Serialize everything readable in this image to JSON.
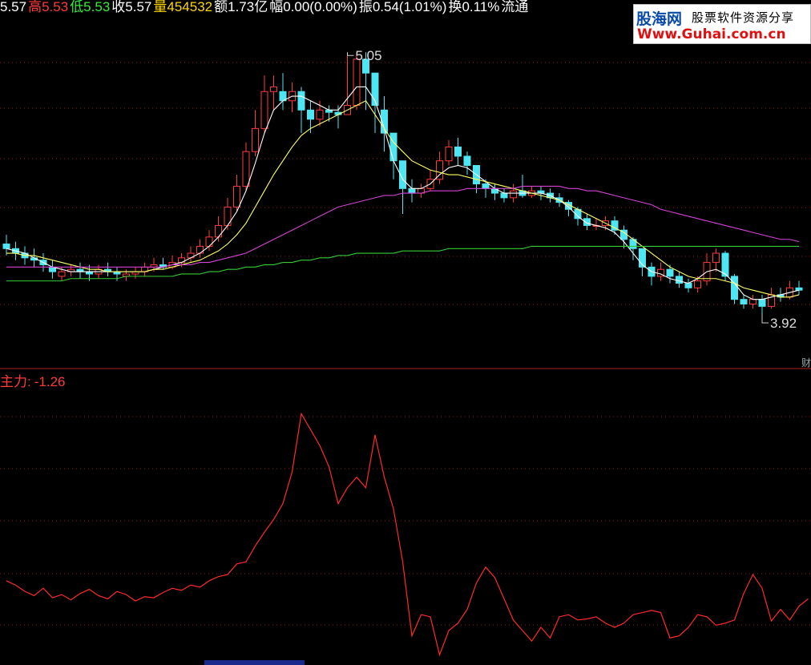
{
  "colors": {
    "background": "#000000",
    "up_candle": "#ff3a3a",
    "down_candle": "#4de6f2",
    "ma5": "#ffffff",
    "ma10": "#ffff66",
    "ma30": "#d442d4",
    "ma60": "#33cc33",
    "indicator": "#ff2a2a",
    "grid": "#8b1a1a"
  },
  "top_info": [
    {
      "text": "5.57",
      "color": "#ffffff"
    },
    {
      "text": "高5.53",
      "color": "#ff3a3a"
    },
    {
      "text": "低5.53",
      "color": "#33ee33"
    },
    {
      "text": "收5.57",
      "color": "#ffffff"
    },
    {
      "text": "量454532",
      "color": "#ffd700"
    },
    {
      "text": "额1.73亿",
      "color": "#ffffff"
    },
    {
      "text": "幅0.00(0.00%)",
      "color": "#ffffff"
    },
    {
      "text": "振0.54(1.01%)",
      "color": "#ffffff"
    },
    {
      "text": "换0.11%",
      "color": "#ffffff"
    },
    {
      "text": "流通",
      "color": "#ffffff"
    }
  ],
  "logo": {
    "brand": "股海网",
    "slogan": "股票软件资源分享",
    "url": "Www.Guhai.com.cn"
  },
  "indicator": {
    "name": "主力:",
    "value": "-1.26"
  },
  "side_tag": "财",
  "chart_data": [
    {
      "type": "candlestick",
      "annotations": [
        {
          "text": "5.05",
          "role": "high"
        },
        {
          "text": "3.92",
          "role": "low"
        }
      ],
      "ylim": [
        3.75,
        5.2
      ],
      "candles": [
        [
          4.22,
          4.2,
          4.26,
          4.17
        ],
        [
          4.2,
          4.18,
          4.23,
          4.15
        ],
        [
          4.18,
          4.16,
          4.21,
          4.13
        ],
        [
          4.16,
          4.15,
          4.2,
          4.12
        ],
        [
          4.15,
          4.13,
          4.18,
          4.1
        ],
        [
          4.12,
          4.1,
          4.15,
          4.07
        ],
        [
          4.08,
          4.1,
          4.12,
          4.06
        ],
        [
          4.1,
          4.11,
          4.13,
          4.08
        ],
        [
          4.11,
          4.1,
          4.14,
          4.07
        ],
        [
          4.1,
          4.09,
          4.13,
          4.06
        ],
        [
          4.09,
          4.11,
          4.13,
          4.07
        ],
        [
          4.11,
          4.1,
          4.14,
          4.08
        ],
        [
          4.1,
          4.09,
          4.12,
          4.06
        ],
        [
          4.08,
          4.09,
          4.11,
          4.06
        ],
        [
          4.09,
          4.1,
          4.12,
          4.07
        ],
        [
          4.1,
          4.12,
          4.14,
          4.08
        ],
        [
          4.12,
          4.13,
          4.16,
          4.1
        ],
        [
          4.13,
          4.12,
          4.16,
          4.11
        ],
        [
          4.12,
          4.14,
          4.17,
          4.11
        ],
        [
          4.14,
          4.16,
          4.18,
          4.12
        ],
        [
          4.16,
          4.18,
          4.21,
          4.14
        ],
        [
          4.18,
          4.21,
          4.24,
          4.16
        ],
        [
          4.21,
          4.25,
          4.28,
          4.19
        ],
        [
          4.25,
          4.3,
          4.34,
          4.23
        ],
        [
          4.3,
          4.38,
          4.42,
          4.28
        ],
        [
          4.38,
          4.47,
          4.52,
          4.36
        ],
        [
          4.47,
          4.62,
          4.66,
          4.45
        ],
        [
          4.62,
          4.72,
          4.8,
          4.6
        ],
        [
          4.72,
          4.88,
          4.95,
          4.7
        ],
        [
          4.88,
          4.9,
          4.95,
          4.8
        ],
        [
          4.88,
          4.84,
          4.96,
          4.8
        ],
        [
          4.84,
          4.88,
          4.92,
          4.79
        ],
        [
          4.88,
          4.8,
          4.9,
          4.7
        ],
        [
          4.8,
          4.76,
          4.84,
          4.7
        ],
        [
          4.76,
          4.8,
          4.84,
          4.73
        ],
        [
          4.8,
          4.79,
          4.82,
          4.75
        ],
        [
          4.79,
          4.78,
          4.82,
          4.72
        ],
        [
          4.78,
          4.82,
          5.05,
          4.78
        ],
        [
          4.82,
          5.02,
          5.05,
          4.8
        ],
        [
          5.02,
          4.96,
          5.05,
          4.8
        ],
        [
          4.96,
          4.82,
          4.85,
          4.7
        ],
        [
          4.8,
          4.7,
          4.86,
          4.62
        ],
        [
          4.7,
          4.58,
          4.6,
          4.5
        ],
        [
          4.58,
          4.46,
          4.48,
          4.35
        ],
        [
          4.46,
          4.44,
          4.5,
          4.4
        ],
        [
          4.44,
          4.46,
          4.48,
          4.42
        ],
        [
          4.46,
          4.5,
          4.54,
          4.45
        ],
        [
          4.5,
          4.58,
          4.62,
          4.48
        ],
        [
          4.58,
          4.64,
          4.67,
          4.56
        ],
        [
          4.64,
          4.6,
          4.68,
          4.56
        ],
        [
          4.6,
          4.56,
          4.62,
          4.52
        ],
        [
          4.56,
          4.48,
          4.55,
          4.44
        ],
        [
          4.48,
          4.46,
          4.5,
          4.42
        ],
        [
          4.46,
          4.44,
          4.48,
          4.41
        ],
        [
          4.44,
          4.42,
          4.46,
          4.4
        ],
        [
          4.42,
          4.45,
          4.48,
          4.4
        ],
        [
          4.45,
          4.43,
          4.52,
          4.42
        ],
        [
          4.43,
          4.45,
          4.47,
          4.42
        ],
        [
          4.45,
          4.44,
          4.47,
          4.41
        ],
        [
          4.44,
          4.42,
          4.46,
          4.4
        ],
        [
          4.42,
          4.4,
          4.44,
          4.38
        ],
        [
          4.4,
          4.37,
          4.41,
          4.34
        ],
        [
          4.37,
          4.33,
          4.38,
          4.3
        ],
        [
          4.33,
          4.3,
          4.35,
          4.28
        ],
        [
          4.3,
          4.3,
          4.33,
          4.28
        ],
        [
          4.3,
          4.32,
          4.34,
          4.28
        ],
        [
          4.32,
          4.28,
          4.34,
          4.26
        ],
        [
          4.28,
          4.24,
          4.3,
          4.2
        ],
        [
          4.24,
          4.2,
          4.25,
          4.15
        ],
        [
          4.2,
          4.12,
          4.2,
          4.08
        ],
        [
          4.12,
          4.08,
          4.14,
          4.04
        ],
        [
          4.08,
          4.11,
          4.14,
          4.06
        ],
        [
          4.11,
          4.08,
          4.13,
          4.05
        ],
        [
          4.08,
          4.05,
          4.1,
          4.03
        ],
        [
          4.05,
          4.03,
          4.07,
          4.01
        ],
        [
          4.03,
          4.06,
          4.08,
          4.01
        ],
        [
          4.06,
          4.14,
          4.18,
          4.04
        ],
        [
          4.14,
          4.18,
          4.2,
          4.1
        ],
        [
          4.18,
          4.08,
          4.19,
          4.06
        ],
        [
          4.08,
          3.98,
          4.09,
          3.96
        ],
        [
          3.98,
          3.96,
          4.0,
          3.94
        ],
        [
          3.96,
          3.98,
          4.0,
          3.94
        ],
        [
          3.98,
          3.95,
          4.0,
          3.92
        ],
        [
          3.95,
          4.0,
          4.03,
          3.94
        ],
        [
          4.0,
          3.99,
          4.03,
          3.97
        ],
        [
          3.99,
          4.03,
          4.06,
          3.98
        ],
        [
          4.03,
          4.02,
          4.06,
          4.0
        ]
      ],
      "series": [
        {
          "name": "MA5",
          "values": [
            4.2,
            4.19,
            4.18,
            4.16,
            4.14,
            4.12,
            4.11,
            4.1,
            4.1,
            4.1,
            4.1,
            4.1,
            4.1,
            4.1,
            4.1,
            4.1,
            4.11,
            4.12,
            4.13,
            4.14,
            4.16,
            4.18,
            4.21,
            4.25,
            4.3,
            4.36,
            4.45,
            4.57,
            4.7,
            4.8,
            4.84,
            4.86,
            4.86,
            4.84,
            4.82,
            4.8,
            4.8,
            4.85,
            4.9,
            4.9,
            4.84,
            4.72,
            4.58,
            4.5,
            4.46,
            4.46,
            4.48,
            4.52,
            4.55,
            4.56,
            4.55,
            4.52,
            4.49,
            4.46,
            4.44,
            4.44,
            4.44,
            4.44,
            4.44,
            4.43,
            4.41,
            4.38,
            4.34,
            4.31,
            4.3,
            4.29,
            4.27,
            4.23,
            4.18,
            4.13,
            4.1,
            4.09,
            4.07,
            4.06,
            4.05,
            4.07,
            4.1,
            4.11,
            4.09,
            4.05,
            4.0,
            3.98,
            3.98,
            3.99,
            4.0,
            4.01,
            4.02
          ]
        },
        {
          "name": "MA10",
          "values": [
            4.18,
            4.18,
            4.17,
            4.17,
            4.16,
            4.15,
            4.14,
            4.13,
            4.12,
            4.11,
            4.11,
            4.1,
            4.1,
            4.1,
            4.1,
            4.1,
            4.11,
            4.11,
            4.12,
            4.13,
            4.14,
            4.15,
            4.17,
            4.19,
            4.22,
            4.26,
            4.31,
            4.38,
            4.45,
            4.52,
            4.58,
            4.64,
            4.69,
            4.72,
            4.74,
            4.76,
            4.78,
            4.8,
            4.82,
            4.84,
            4.78,
            4.72,
            4.66,
            4.62,
            4.58,
            4.56,
            4.54,
            4.53,
            4.52,
            4.52,
            4.51,
            4.5,
            4.49,
            4.48,
            4.47,
            4.46,
            4.45,
            4.44,
            4.43,
            4.42,
            4.41,
            4.39,
            4.37,
            4.35,
            4.33,
            4.31,
            4.29,
            4.27,
            4.24,
            4.21,
            4.18,
            4.15,
            4.12,
            4.1,
            4.08,
            4.07,
            4.07,
            4.07,
            4.06,
            4.05,
            4.03,
            4.02,
            4.01,
            4.0,
            3.99,
            3.99,
            4.0
          ]
        },
        {
          "name": "MA30",
          "values": [
            4.12,
            4.12,
            4.12,
            4.12,
            4.12,
            4.12,
            4.12,
            4.12,
            4.12,
            4.12,
            4.12,
            4.12,
            4.12,
            4.12,
            4.12,
            4.12,
            4.12,
            4.12,
            4.13,
            4.13,
            4.13,
            4.14,
            4.14,
            4.15,
            4.16,
            4.17,
            4.18,
            4.2,
            4.22,
            4.24,
            4.26,
            4.28,
            4.3,
            4.32,
            4.34,
            4.36,
            4.38,
            4.39,
            4.4,
            4.41,
            4.42,
            4.43,
            4.43,
            4.44,
            4.44,
            4.44,
            4.45,
            4.45,
            4.45,
            4.45,
            4.46,
            4.46,
            4.46,
            4.46,
            4.46,
            4.46,
            4.47,
            4.47,
            4.47,
            4.47,
            4.47,
            4.46,
            4.46,
            4.45,
            4.45,
            4.44,
            4.43,
            4.42,
            4.41,
            4.4,
            4.39,
            4.37,
            4.36,
            4.35,
            4.34,
            4.33,
            4.32,
            4.31,
            4.3,
            4.29,
            4.28,
            4.27,
            4.26,
            4.25,
            4.24,
            4.24,
            4.23
          ]
        },
        {
          "name": "MA60",
          "values": [
            4.06,
            4.06,
            4.06,
            4.06,
            4.06,
            4.06,
            4.06,
            4.07,
            4.07,
            4.07,
            4.07,
            4.07,
            4.07,
            4.08,
            4.08,
            4.08,
            4.08,
            4.08,
            4.08,
            4.09,
            4.09,
            4.09,
            4.1,
            4.1,
            4.11,
            4.11,
            4.12,
            4.12,
            4.13,
            4.13,
            4.14,
            4.14,
            4.15,
            4.15,
            4.16,
            4.16,
            4.17,
            4.17,
            4.18,
            4.18,
            4.18,
            4.18,
            4.18,
            4.19,
            4.19,
            4.19,
            4.19,
            4.19,
            4.2,
            4.2,
            4.2,
            4.2,
            4.2,
            4.2,
            4.2,
            4.2,
            4.2,
            4.21,
            4.21,
            4.21,
            4.21,
            4.21,
            4.21,
            4.21,
            4.21,
            4.21,
            4.21,
            4.21,
            4.21,
            4.21,
            4.21,
            4.21,
            4.21,
            4.21,
            4.21,
            4.21,
            4.21,
            4.21,
            4.21,
            4.21,
            4.21,
            4.21,
            4.21,
            4.21,
            4.21,
            4.21,
            4.21
          ]
        }
      ]
    },
    {
      "type": "line",
      "series": [
        {
          "name": "主力",
          "values": [
            2.2,
            1.8,
            1.2,
            0.8,
            1.5,
            0.6,
            0.9,
            0.4,
            1.0,
            1.4,
            0.8,
            0.5,
            1.2,
            0.9,
            0.3,
            0.7,
            0.6,
            1.1,
            1.5,
            1.3,
            1.8,
            1.6,
            2.2,
            2.6,
            2.8,
            3.8,
            4.0,
            5.5,
            6.8,
            8.0,
            9.5,
            12.5,
            18.0,
            16.5,
            15.0,
            13.0,
            9.5,
            11.0,
            12.0,
            11.0,
            16.0,
            12.0,
            9.0,
            4.0,
            -3.0,
            -1.0,
            -1.2,
            -4.8,
            -2.5,
            -1.8,
            -0.5,
            2.0,
            3.5,
            2.5,
            0.5,
            -1.5,
            -2.5,
            -3.5,
            -2.2,
            -3.2,
            -1.2,
            -1.0,
            -1.5,
            -1.4,
            -1.2,
            -1.8,
            -2.2,
            -1.8,
            -1.0,
            -0.8,
            -0.6,
            -0.8,
            -3.2,
            -3.0,
            -2.2,
            -1.0,
            -1.2,
            -2.0,
            -1.8,
            -1.5,
            1.0,
            2.8,
            1.5,
            -1.6,
            -0.5,
            -1.5,
            -0.2,
            0.5
          ]
        }
      ],
      "ylim": [
        -5,
        20
      ]
    }
  ]
}
